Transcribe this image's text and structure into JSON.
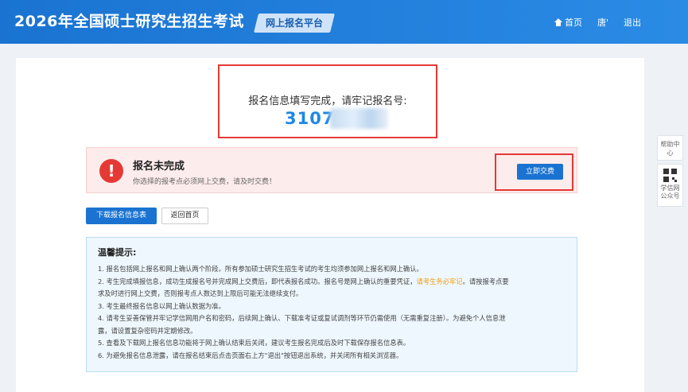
{
  "header": {
    "title": "2026年全国硕士研究生招生考试",
    "platform": "网上报名平台",
    "nav_home": "首页",
    "nav_user": "唐'",
    "nav_logout": "退出"
  },
  "registration": {
    "caption": "报名信息填写完成，请牢记报名号:",
    "number_visible": "3107"
  },
  "alert": {
    "icon": "!",
    "title": "报名未完成",
    "desc": "你选择的报考点必须网上交费，请及时交费！",
    "pay_button": "立即交费"
  },
  "actions": {
    "download": "下载报名信息表",
    "back": "返回首页"
  },
  "tips": {
    "title": "温馨提示:",
    "items": [
      "1. 报名包括网上报名和网上确认两个阶段。所有参加硕士研究生招生考试的考生均须参加网上报名和网上确认。",
      "2. 考生完成填报信息，成功生成报名号并完成网上交费后，即代表报名成功。报名号是网上确认的重要凭证，",
      "请考生务必牢记",
      "。请按报考点要",
      "求及时进行网上交费，否则报考点人数达到上限后可能无法继续支付。",
      "3. 考生最终报名信息以网上确认数据为准。",
      "4. 请考生妥善保管并牢记学信网用户名和密码，后续网上确认、下载准考证或复试调剂等环节仍需使用（无需重复注册）。为避免个人信息泄",
      "露，请设置复杂密码并定期修改。",
      "5. 查看及下载网上报名信息功能将于网上确认结束后关闭，建议考生报名完成后及时下载保存报名信息表。",
      "6. 为避免报名信息泄露，请在报名结束后点击页面右上方\"退出\"按钮退出系统，并关闭所有相关浏览器。"
    ]
  },
  "sidebar": {
    "help": "帮助中心",
    "qr_line1": "学信网",
    "qr_line2": "公众号"
  },
  "colors": {
    "primary": "#1a73d1",
    "accent_number": "#1e88e5",
    "alert_red": "#e53935",
    "tip_emphasis": "#f39c12"
  }
}
